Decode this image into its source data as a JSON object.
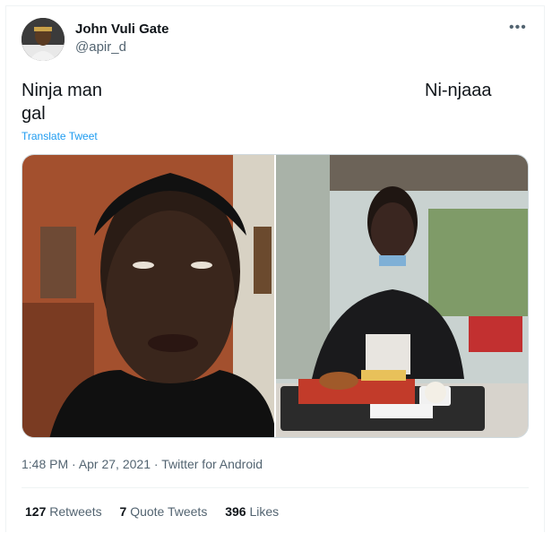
{
  "user": {
    "name": "John Vuli Gate",
    "handle": "@apir_d"
  },
  "more_label": "•••",
  "tweet": {
    "left_line1": "Ninja man",
    "left_line2": "gal",
    "right_line1": "Ni-njaaa",
    "translate_label": "Translate Tweet"
  },
  "meta": {
    "time": "1:48 PM",
    "sep1": " · ",
    "date": "Apr 27, 2021",
    "sep2": " · ",
    "source": "Twitter for Android"
  },
  "stats": {
    "retweets_count": "127",
    "retweets_label": "Retweets",
    "quotes_count": "7",
    "quotes_label": "Quote Tweets",
    "likes_count": "396",
    "likes_label": "Likes"
  },
  "colors": {
    "link": "#1d9bf0",
    "secondary_text": "#536471",
    "primary_text": "#0f1419",
    "border": "#cfd9de"
  }
}
